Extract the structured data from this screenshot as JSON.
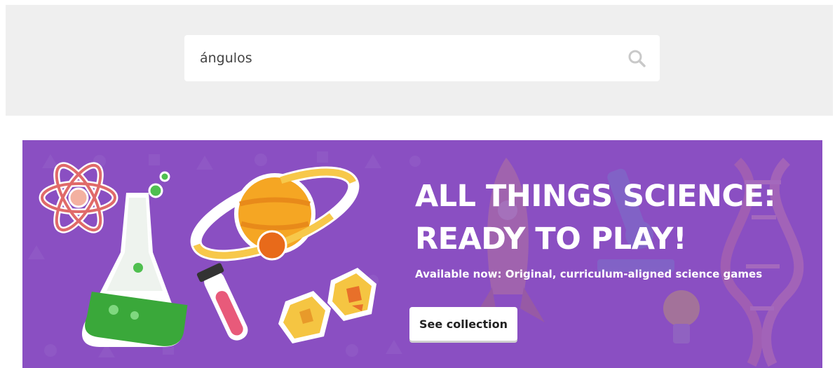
{
  "search": {
    "value": "ángulos",
    "icon": "search-icon"
  },
  "banner": {
    "title_line1": "ALL THINGS SCIENCE:",
    "title_line2": "READY TO PLAY!",
    "subtitle": "Available now: Original, curriculum-aligned science games",
    "cta_label": "See collection",
    "background_color": "#8a4fc2",
    "illustrations": [
      "atom-icon",
      "flask-icon",
      "planet-icon",
      "test-tube-icon",
      "crystal-icon",
      "rocket-icon",
      "microscope-icon",
      "dna-icon",
      "lightbulb-icon"
    ]
  },
  "colors": {
    "search_band": "#efefef",
    "banner_purple": "#8a4fc2",
    "button_bg": "#ffffff"
  }
}
